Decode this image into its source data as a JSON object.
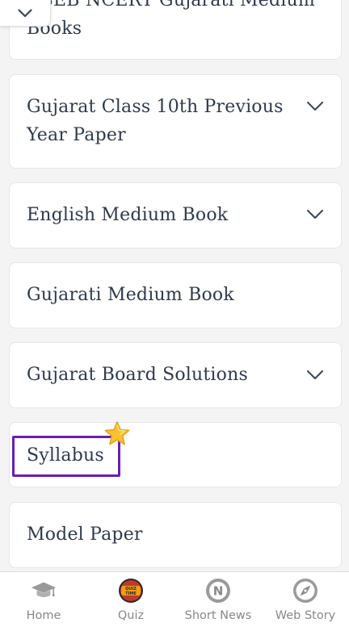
{
  "list": {
    "top_partial": {
      "line1": "GSEB NCERT Gujarati Medium",
      "line2": "Books"
    },
    "items": [
      {
        "line1": "Gujarat Class 10th Previous",
        "line2": "Year Paper",
        "expandable": true
      },
      {
        "label": "English Medium Book",
        "expandable": true
      },
      {
        "label": "Gujarati Medium Book",
        "expandable": false
      },
      {
        "label": "Gujarat Board Solutions",
        "expandable": true
      },
      {
        "label": "Syllabus",
        "expandable": false,
        "highlighted": true
      },
      {
        "label": "Model Paper",
        "expandable": false
      }
    ]
  },
  "bottom_nav": {
    "items": [
      {
        "label": "Home",
        "icon": "graduation-cap-icon"
      },
      {
        "label": "Quiz",
        "icon": "quiz-time-icon",
        "icon_text": "QUIZ TIME"
      },
      {
        "label": "Short News",
        "icon": "news-n-icon",
        "icon_text": "N"
      },
      {
        "label": "Web Story",
        "icon": "compass-icon"
      }
    ]
  },
  "colors": {
    "text": "#2e3a4e",
    "highlight_border": "#6a1fb3",
    "nav_label": "#888888",
    "background": "#f4f4f4"
  }
}
